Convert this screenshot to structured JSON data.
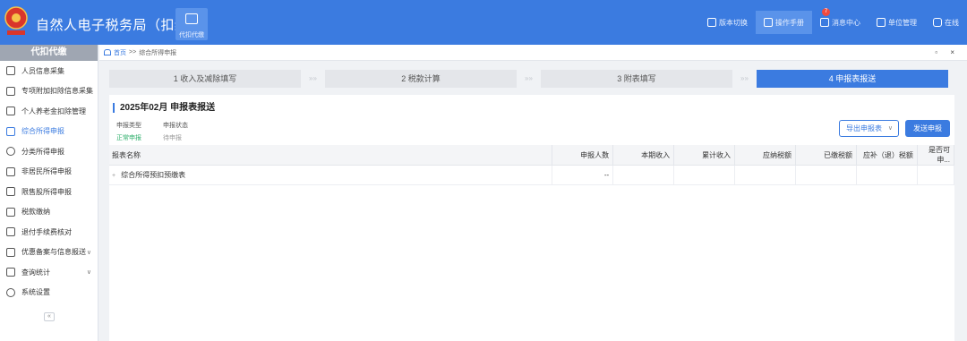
{
  "header": {
    "app_title": "自然人电子税务局（扣缴端）",
    "tile_label": "代扣代缴",
    "nav": [
      {
        "label": "版本切换",
        "icon": "version-switch-icon"
      },
      {
        "label": "操作手册",
        "icon": "manual-icon"
      },
      {
        "label": "消息中心",
        "icon": "message-icon",
        "badge": "7"
      },
      {
        "label": "单位管理",
        "icon": "company-icon"
      },
      {
        "label": "在线",
        "icon": "online-icon"
      }
    ]
  },
  "sidebar": {
    "title": "代扣代缴",
    "items": [
      {
        "label": "人员信息采集",
        "icon": "person-icon"
      },
      {
        "label": "专项附加扣除信息采集",
        "icon": "grid-icon"
      },
      {
        "label": "个人养老金扣除管理",
        "icon": "pension-icon"
      },
      {
        "label": "综合所得申报",
        "icon": "layers-icon",
        "active": true
      },
      {
        "label": "分类所得申报",
        "icon": "clock-icon"
      },
      {
        "label": "非居民所得申报",
        "icon": "user-icon"
      },
      {
        "label": "限售股所得申报",
        "icon": "chart-icon"
      },
      {
        "label": "税款缴纳",
        "icon": "wallet-icon"
      },
      {
        "label": "退付手续费核对",
        "icon": "check-icon"
      },
      {
        "label": "优惠备案与信息报送",
        "icon": "doc-icon",
        "chevron": "∨"
      },
      {
        "label": "查询统计",
        "icon": "search-icon",
        "chevron": "∨"
      },
      {
        "label": "系统设置",
        "icon": "gear-icon"
      }
    ],
    "collapse_glyph": "«"
  },
  "breadcrumb": {
    "home": "首页",
    "sep": ">>",
    "current": "综合所得申报",
    "window_controls": "▫ ×"
  },
  "steps": [
    {
      "label": "1 收入及减除填写",
      "active": false
    },
    {
      "label": "2 税款计算",
      "active": false
    },
    {
      "label": "3 附表填写",
      "active": false
    },
    {
      "label": "4 申报表报送",
      "active": true
    }
  ],
  "step_separator": "»»",
  "panel": {
    "title": "2025年02月  申报表报送",
    "meta": [
      {
        "key": "申报类型",
        "value": "正常申报"
      },
      {
        "key": "申报状态",
        "value": "待申报"
      }
    ],
    "export_label": "导出申报表",
    "export_chevron": "∨",
    "send_label": "发送申报"
  },
  "table": {
    "columns": [
      "报表名称",
      "申报人数",
      "本期收入",
      "累计收入",
      "应纳税额",
      "已缴税额",
      "应补（退）税额",
      "是否可申..."
    ],
    "rows": [
      {
        "expand": "+",
        "cells": [
          "综合所得预扣预缴表",
          "--",
          "",
          "",
          "",
          "",
          "",
          ""
        ]
      }
    ]
  },
  "colors": {
    "primary": "#3b7be0",
    "success": "#2eaf6b",
    "muted": "#999999"
  }
}
